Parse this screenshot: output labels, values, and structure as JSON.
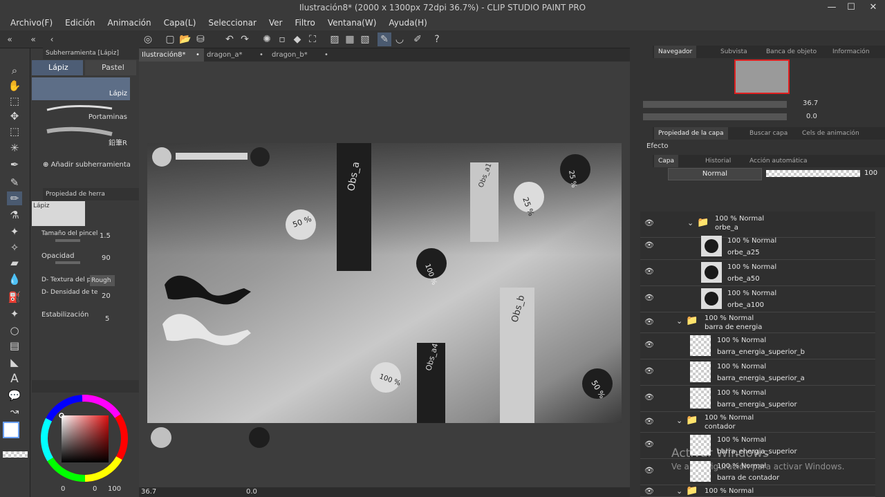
{
  "window": {
    "title": "Ilustración8* (2000 x 1300px 72dpi 36.7%)  - CLIP STUDIO PAINT PRO",
    "minimize": "—",
    "maximize": "☐",
    "close": "✕"
  },
  "menu": [
    "Archivo(F)",
    "Edición",
    "Animación",
    "Capa(L)",
    "Seleccionar",
    "Ver",
    "Filtro",
    "Ventana(W)",
    "Ayuda(H)"
  ],
  "tabs": [
    "Ilustración8*",
    "dragon_a*",
    "dragon_b*"
  ],
  "subtool": {
    "header": "Subherramienta [Lápiz]",
    "tab_pencil": "Lápiz",
    "tab_pastel": "Pastel",
    "brushes": [
      "Lápiz",
      "Portaminas",
      "鉛筆R"
    ],
    "add_label": "Añadir subherramienta"
  },
  "tool_property": {
    "header": "Propiedad de herra",
    "preview_label": "Lápiz",
    "brush_size_label": "Tamaño del pincel",
    "brush_size_value": "1.5",
    "opacity_label": "Opacidad",
    "opacity_value": "90",
    "paper_texture_label": "D- Textura del papel",
    "paper_texture_value": "Rough p",
    "texture_density_label": "D- Densidad de te",
    "texture_density_value": "20",
    "stabilization_label": "Estabilización",
    "stabilization_value": "5"
  },
  "color_wheel": {
    "values": [
      "0",
      "0",
      "100"
    ]
  },
  "canvas": {
    "labels": [
      "Obs_a",
      "Obs_a1",
      "Obs_a4",
      "Obs_b",
      "50 %",
      "25 %",
      "100 %",
      "25 %",
      "100 %",
      "50 %"
    ]
  },
  "statusbar": {
    "zoom": "36.7",
    "rotation": "0.0"
  },
  "navigator": {
    "tabs": [
      "Navegador",
      "Subvista",
      "Banca de objeto",
      "Información"
    ],
    "zoom": "36.7",
    "rotation": "0.0"
  },
  "layer_property": {
    "tabs": [
      "Propiedad de la capa",
      "Buscar capa",
      "Cels de animación"
    ],
    "effect_label": "Efecto"
  },
  "layers_panel": {
    "tabs": [
      "Capa",
      "Historial",
      "Acción automática"
    ],
    "blend_mode": "Normal",
    "opacity": "100",
    "layers": [
      {
        "mode": "100 % Normal",
        "name": "orbe_a",
        "type": "folder"
      },
      {
        "mode": "100 % Normal",
        "name": "orbe_a25",
        "type": "layer"
      },
      {
        "mode": "100 % Normal",
        "name": "orbe_a50",
        "type": "layer"
      },
      {
        "mode": "100 % Normal",
        "name": "orbe_a100",
        "type": "layer"
      },
      {
        "mode": "100 % Normal",
        "name": "barra de energia",
        "type": "folder"
      },
      {
        "mode": "100 % Normal",
        "name": "barra_energia_superior_b",
        "type": "layer"
      },
      {
        "mode": "100 % Normal",
        "name": "barra_energia_superior_a",
        "type": "layer"
      },
      {
        "mode": "100 % Normal",
        "name": "barra_energia_superior",
        "type": "layer"
      },
      {
        "mode": "100 % Normal",
        "name": "contador",
        "type": "folder"
      },
      {
        "mode": "100 % Normal",
        "name": "barra_energia_superior",
        "type": "layer"
      },
      {
        "mode": "100 % Normal",
        "name": "barra de contador",
        "type": "layer"
      },
      {
        "mode": "100 % Normal",
        "name": "",
        "type": "folder"
      }
    ]
  },
  "watermark": {
    "title": "Activar Windows",
    "subtitle": "Ve a Configuración para activar Windows."
  }
}
